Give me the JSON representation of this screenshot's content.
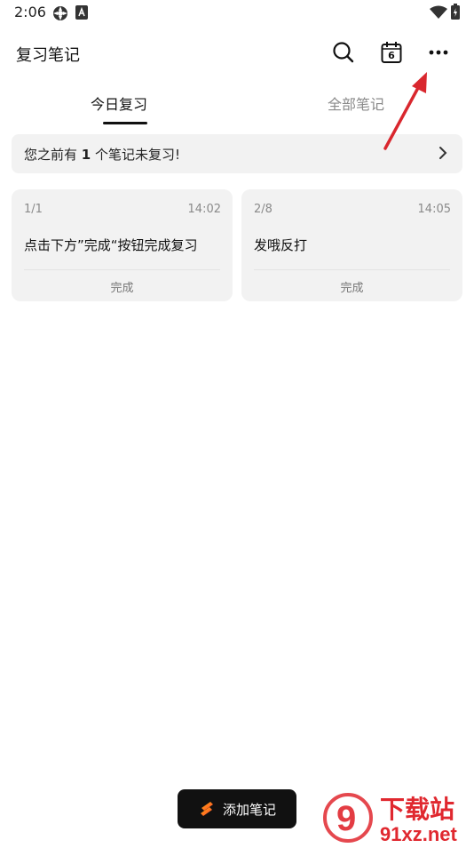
{
  "status_bar": {
    "time": "2:06"
  },
  "header": {
    "title": "复习笔记",
    "calendar_day": "6"
  },
  "tabs": [
    {
      "label": "今日复习",
      "active": true
    },
    {
      "label": "全部笔记",
      "active": false
    }
  ],
  "notice": {
    "prefix": "您之前有",
    "count": "1",
    "suffix": "个笔记未复习!"
  },
  "cards": [
    {
      "index": "1/1",
      "time": "14:02",
      "text": "点击下方”完成“按钮完成复习",
      "action": "完成"
    },
    {
      "index": "2/8",
      "time": "14:05",
      "text": "发哦反打",
      "action": "完成"
    }
  ],
  "add_button": {
    "label": "添加笔记"
  },
  "watermark": {
    "text_top": "下载站",
    "text_bottom": "91xz.net",
    "logo": "9"
  },
  "colors": {
    "accent": "#111111",
    "card_bg": "#f2f2f2",
    "annotation_arrow": "#d9272e",
    "watermark": "#e0282f"
  }
}
